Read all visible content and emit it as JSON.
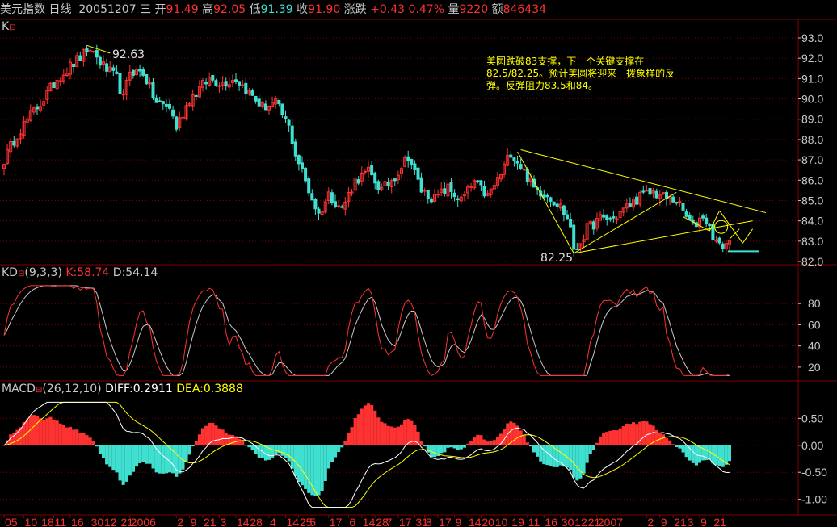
{
  "header": {
    "name": "美元指数",
    "period": "日线",
    "date": "20051207",
    "weekday": "三",
    "open_label": "开",
    "open": "91.49",
    "high_label": "高",
    "high": "92.05",
    "low_label": "低",
    "low": "91.39",
    "close_label": "收",
    "close": "91.90",
    "change_label": "涨跌",
    "change": "+0.43",
    "change_pct": "0.47%",
    "volume_label": "量",
    "volume": "9220",
    "amount_label": "额",
    "amount": "846434"
  },
  "panels": {
    "k": {
      "label": "K",
      "icon": "minimize-icon"
    },
    "kd": {
      "label": "KD",
      "params": "(9,3,3)",
      "k_label": "K:58.74",
      "d_label": "D:54.14"
    },
    "macd": {
      "label": "MACD",
      "params": "(26,12,10)",
      "diff_label": "DIFF:0.2911",
      "dea_label": "DEA:0.3888"
    }
  },
  "annotation": {
    "line1": "美圆跌破83支撑，下一个关键支撑在",
    "line2": "82.5/82.25。预计美圆将迎来一拨象样的反",
    "line3": "弹。反弹阻力83.5和84。"
  },
  "price_labels": {
    "high": "92.63",
    "low": "82.25"
  },
  "x_ticks": [
    {
      "label": "05",
      "i": 0
    },
    {
      "label": "10",
      "i": 6
    },
    {
      "label": "18",
      "i": 11
    },
    {
      "label": "11",
      "i": 15
    },
    {
      "label": "16",
      "i": 20
    },
    {
      "label": "30",
      "i": 26
    },
    {
      "label": "12",
      "i": 30
    },
    {
      "label": "21",
      "i": 35
    },
    {
      "label": "2006",
      "i": 38
    },
    {
      "label": "2",
      "i": 52
    },
    {
      "label": "9",
      "i": 56
    },
    {
      "label": "21",
      "i": 60
    },
    {
      "label": "3",
      "i": 65
    },
    {
      "label": "14",
      "i": 70
    },
    {
      "label": "28",
      "i": 74
    },
    {
      "label": "4",
      "i": 80
    },
    {
      "label": "14",
      "i": 85
    },
    {
      "label": "25",
      "i": 89
    },
    {
      "label": "5",
      "i": 92
    },
    {
      "label": "17",
      "i": 98
    },
    {
      "label": "6",
      "i": 104
    },
    {
      "label": "14",
      "i": 108
    },
    {
      "label": "28",
      "i": 112
    },
    {
      "label": "7",
      "i": 115
    },
    {
      "label": "17",
      "i": 119
    },
    {
      "label": "31",
      "i": 124
    },
    {
      "label": "8",
      "i": 127
    },
    {
      "label": "17",
      "i": 131
    },
    {
      "label": "9",
      "i": 136
    },
    {
      "label": "14",
      "i": 140
    },
    {
      "label": "20",
      "i": 144
    },
    {
      "label": "10",
      "i": 148
    },
    {
      "label": "19",
      "i": 153
    },
    {
      "label": "11",
      "i": 158
    },
    {
      "label": "16",
      "i": 163
    },
    {
      "label": "30",
      "i": 168
    },
    {
      "label": "12",
      "i": 172
    },
    {
      "label": "21",
      "i": 176
    },
    {
      "label": "2007",
      "i": 179
    },
    {
      "label": "2",
      "i": 194
    },
    {
      "label": "9",
      "i": 198
    },
    {
      "label": "21",
      "i": 202
    },
    {
      "label": "3",
      "i": 206
    },
    {
      "label": "9",
      "i": 210
    },
    {
      "label": "21",
      "i": 214
    }
  ],
  "chart_data": [
    {
      "type": "candlestick",
      "title": "",
      "y_ticks": [
        "82.0",
        "83.0",
        "84.0",
        "85.0",
        "86.0",
        "87.0",
        "88.0",
        "89.0",
        "90.0",
        "91.0",
        "92.0",
        "93.0"
      ],
      "ylim": [
        82.0,
        93.0
      ],
      "key_points": [
        {
          "label": "high",
          "date_index": 25,
          "value": 92.63
        },
        {
          "label": "low",
          "date_index": 172,
          "value": 82.25
        }
      ],
      "anchors": [
        [
          0,
          87.0
        ],
        [
          4,
          88.3
        ],
        [
          8,
          89.2
        ],
        [
          12,
          90.0
        ],
        [
          16,
          91.0
        ],
        [
          20,
          91.6
        ],
        [
          24,
          92.2
        ],
        [
          26,
          92.5
        ],
        [
          30,
          91.6
        ],
        [
          34,
          91.0
        ],
        [
          36,
          90.0
        ],
        [
          38,
          91.4
        ],
        [
          42,
          91.3
        ],
        [
          46,
          89.8
        ],
        [
          50,
          89.6
        ],
        [
          52,
          88.6
        ],
        [
          56,
          90.0
        ],
        [
          62,
          91.0
        ],
        [
          66,
          90.8
        ],
        [
          70,
          91.0
        ],
        [
          74,
          90.3
        ],
        [
          78,
          89.6
        ],
        [
          82,
          89.8
        ],
        [
          86,
          88.6
        ],
        [
          88,
          87.3
        ],
        [
          92,
          85.5
        ],
        [
          95,
          84.3
        ],
        [
          98,
          85.3
        ],
        [
          102,
          84.6
        ],
        [
          106,
          86.0
        ],
        [
          110,
          86.4
        ],
        [
          114,
          85.5
        ],
        [
          118,
          86.2
        ],
        [
          122,
          87.2
        ],
        [
          126,
          85.5
        ],
        [
          130,
          85.1
        ],
        [
          134,
          85.6
        ],
        [
          138,
          85.0
        ],
        [
          142,
          85.9
        ],
        [
          146,
          85.2
        ],
        [
          150,
          86.3
        ],
        [
          153,
          87.4
        ],
        [
          156,
          86.7
        ],
        [
          160,
          85.6
        ],
        [
          164,
          85.3
        ],
        [
          168,
          84.7
        ],
        [
          171,
          83.8
        ],
        [
          173,
          82.7
        ],
        [
          176,
          83.6
        ],
        [
          180,
          84.1
        ],
        [
          184,
          84.1
        ],
        [
          188,
          84.7
        ],
        [
          192,
          85.2
        ],
        [
          196,
          85.4
        ],
        [
          200,
          85.1
        ],
        [
          203,
          85.0
        ],
        [
          206,
          84.2
        ],
        [
          208,
          83.7
        ],
        [
          211,
          84.3
        ],
        [
          214,
          83.3
        ],
        [
          216,
          82.7
        ],
        [
          218,
          82.9
        ]
      ],
      "annotations": [
        "美圆跌破83支撑，下一个关键支撑在",
        "82.5/82.25。预计美圆将迎来一拨象样的反",
        "弹。反弹阻力83.5和84。"
      ]
    },
    {
      "type": "line",
      "title": "KD(9,3,3)",
      "y_ticks": [
        "20",
        "40",
        "60",
        "80"
      ],
      "ylim": [
        10,
        100
      ],
      "series": [
        {
          "name": "K",
          "latest": 58.74,
          "color": "#ff3232"
        },
        {
          "name": "D",
          "latest": 54.14,
          "color": "#c8c8c8"
        }
      ]
    },
    {
      "type": "bar",
      "title": "MACD(26,12,10)",
      "y_ticks": [
        "0.50",
        "0.00",
        "-0.50",
        "-1.00"
      ],
      "ylim": [
        -1.2,
        0.85
      ],
      "series": [
        {
          "name": "DIFF",
          "latest": 0.2911,
          "color": "#ffffff"
        },
        {
          "name": "DEA",
          "latest": 0.3888,
          "color": "#ffff00"
        }
      ]
    }
  ],
  "colors": {
    "up": "#ff3232",
    "down": "#40e0d0",
    "grid": "#800000",
    "axis": "#c8c8c8",
    "annotation": "#ffff00"
  }
}
